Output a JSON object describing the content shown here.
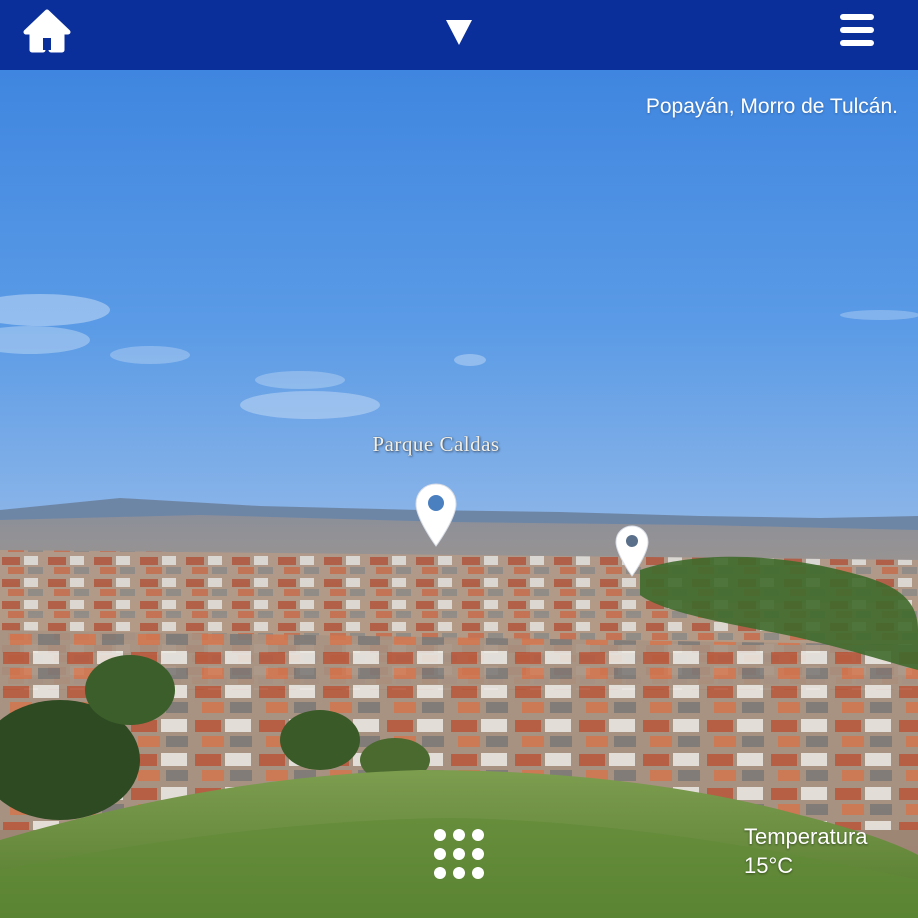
{
  "topbar": {
    "background": "#0b2f9a",
    "home_icon": "home-icon",
    "toggle_icon": "triangle-down-icon",
    "menu_icon": "hamburger-menu-icon"
  },
  "scene": {
    "location_title": "Popayán, Morro de Tulcán.",
    "hotspots": [
      {
        "label": "Parque Caldas",
        "icon": "map-pin-icon"
      },
      {
        "label": "",
        "icon": "map-pin-icon"
      }
    ]
  },
  "bottom": {
    "gallery_icon": "dots-grid-icon",
    "weather": {
      "label": "Temperatura",
      "value": "15°C"
    }
  }
}
